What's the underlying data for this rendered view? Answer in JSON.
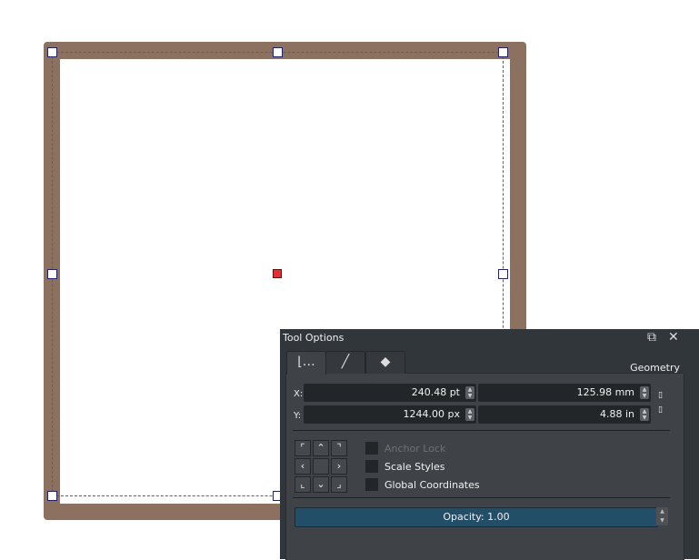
{
  "panel": {
    "title": "Tool Options",
    "section": "Geometry",
    "tabs": [
      {
        "icon": "geometry-icon",
        "glyph": "⌊…"
      },
      {
        "icon": "stroke-icon",
        "glyph": "╱"
      },
      {
        "icon": "fill-icon",
        "glyph": "◆"
      }
    ],
    "x_label": "X:",
    "y_label": "Y:",
    "x_value": "240.48 pt",
    "x_value2": "125.98 mm",
    "y_value": "1244.00 px",
    "y_value2": "4.88 in",
    "anchor_lock": "Anchor Lock",
    "scale_styles": "Scale Styles",
    "global_coordinates": "Global Coordinates",
    "opacity": "Opacity: 1.00"
  },
  "colors": {
    "shape_stroke": "#8c7060",
    "opacity_bar": "#234e68"
  }
}
